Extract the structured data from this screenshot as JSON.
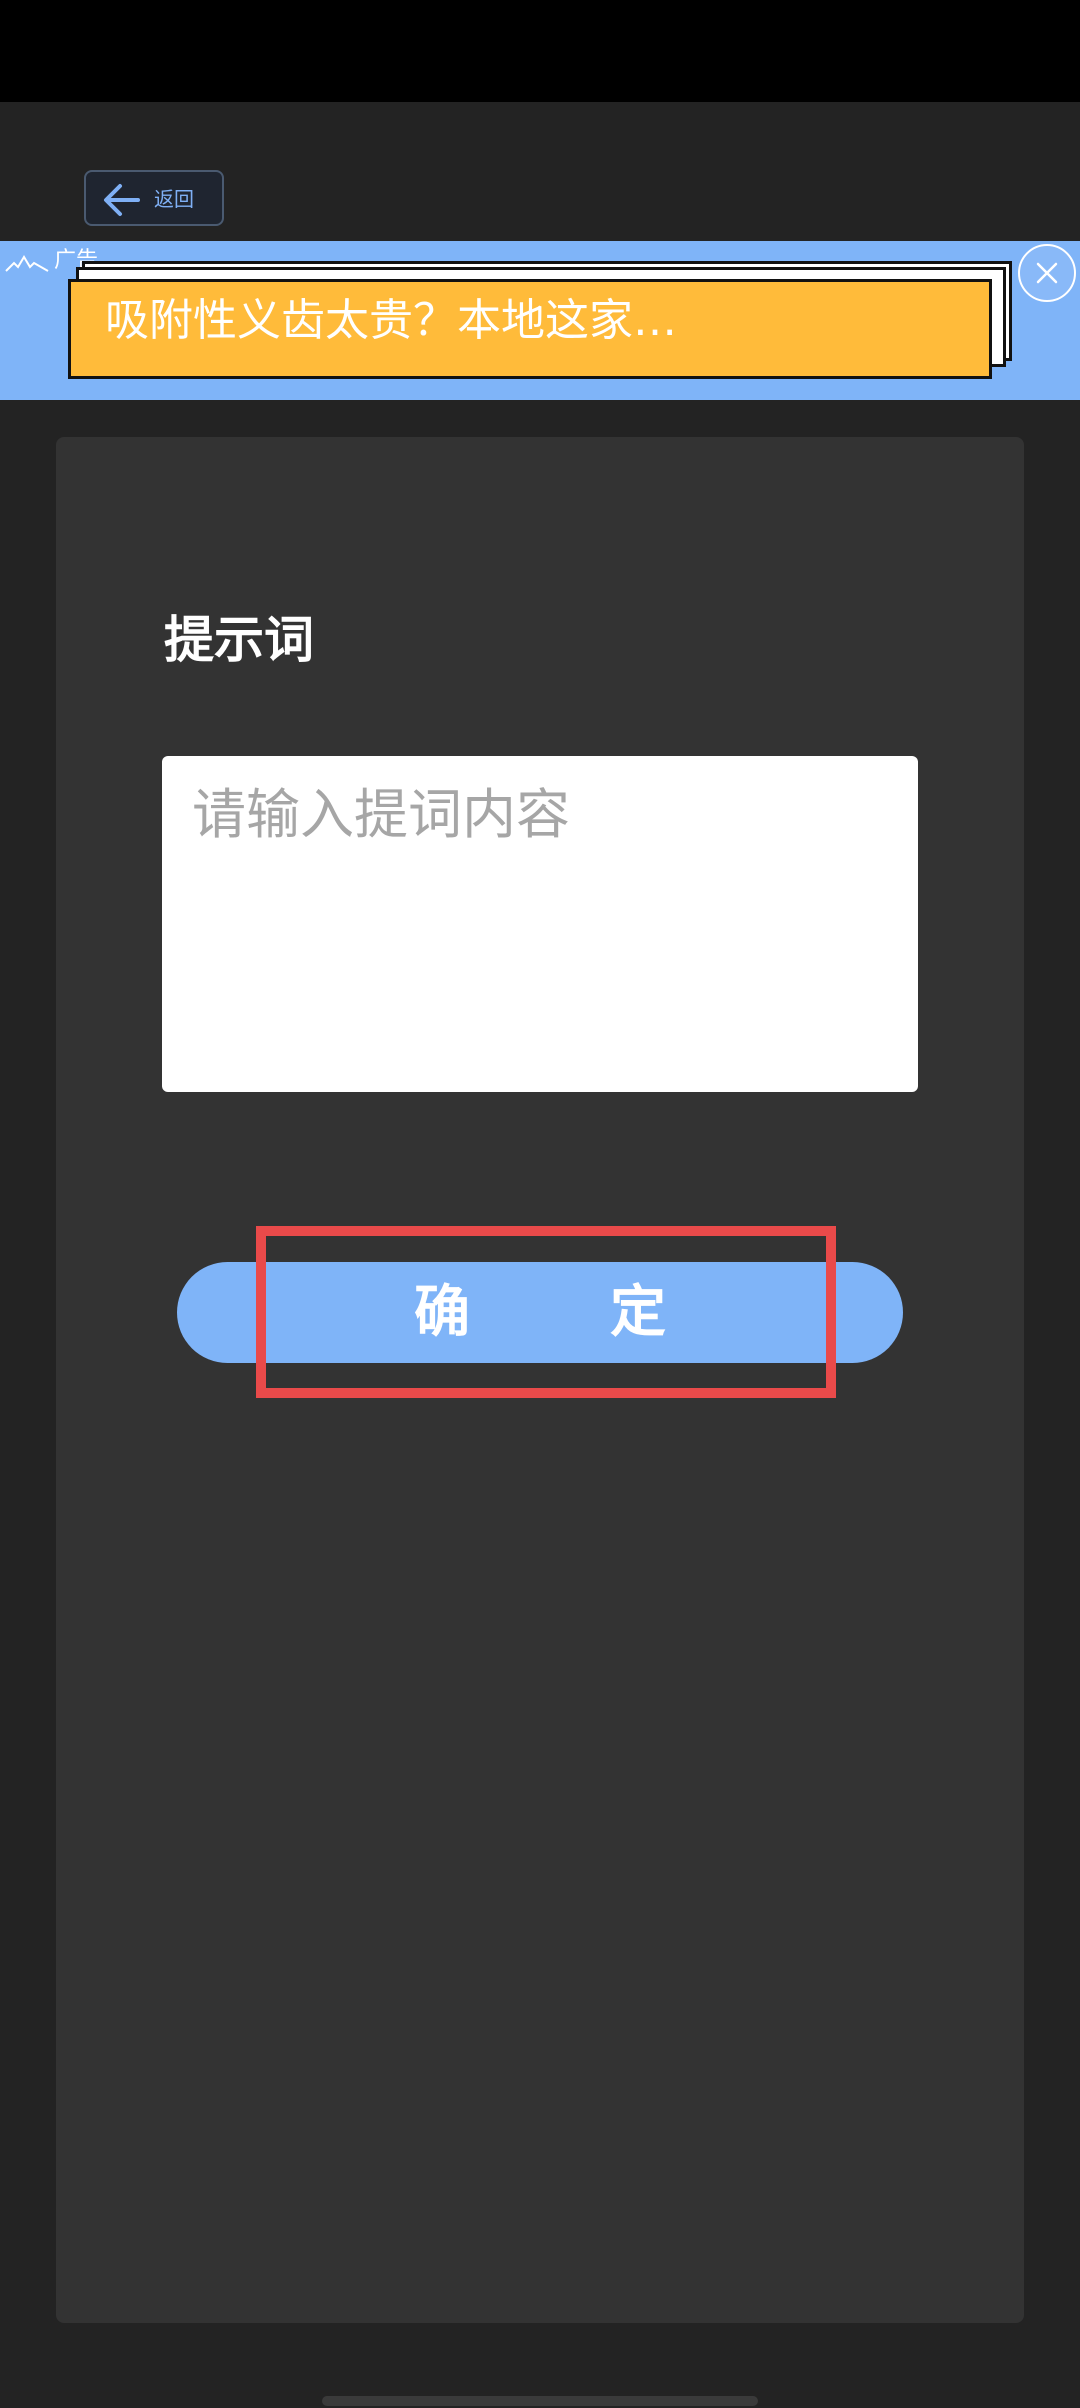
{
  "header": {
    "back_label": "返回"
  },
  "ad": {
    "tag": "广告",
    "headline": "吸附性义齿太贵？本地这家…",
    "close_icon": "close-icon"
  },
  "form": {
    "title": "提示词",
    "input_placeholder": "请输入提词内容",
    "input_value": "",
    "confirm_label": "确定"
  },
  "colors": {
    "accent": "#7fb4f8",
    "ad_card": "#ffbb3a",
    "highlight": "#e94a4a",
    "panel": "#333333",
    "background": "#232323"
  }
}
